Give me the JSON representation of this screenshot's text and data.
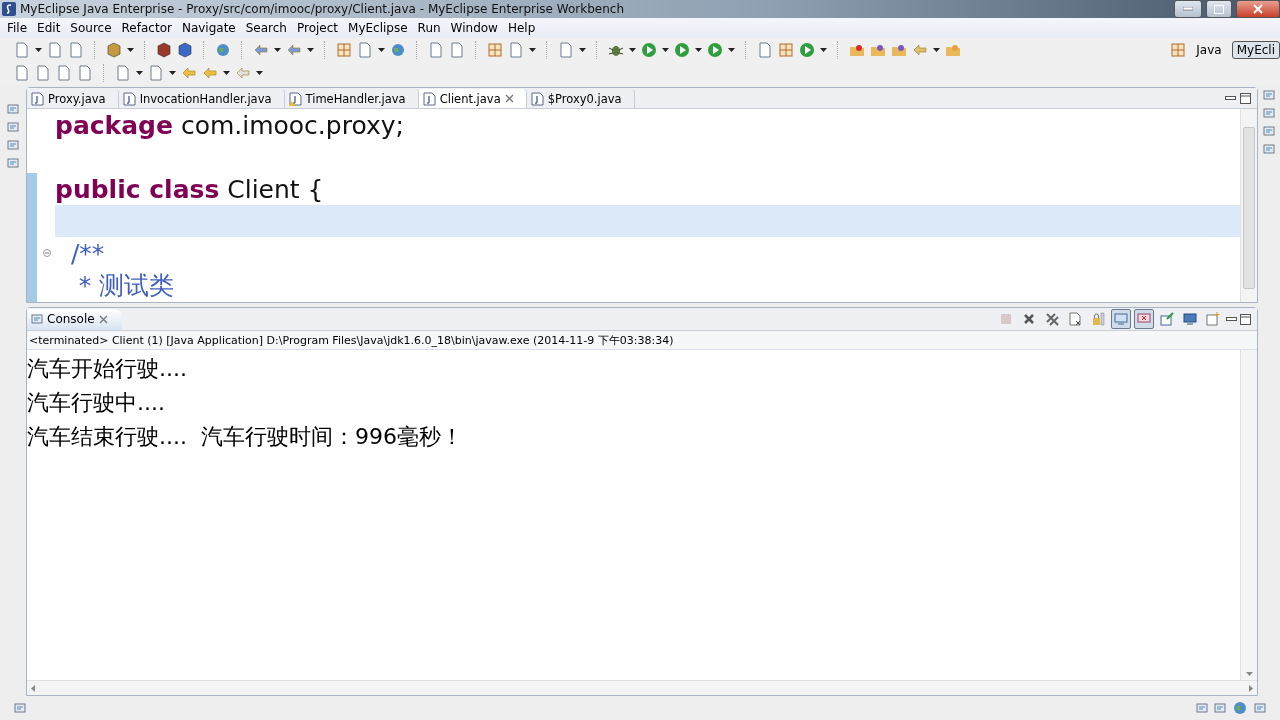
{
  "window": {
    "title": "MyEclipse Java Enterprise - Proxy/src/com/imooc/proxy/Client.java - MyEclipse Enterprise Workbench"
  },
  "menu": [
    "File",
    "Edit",
    "Source",
    "Refactor",
    "Navigate",
    "Search",
    "Project",
    "MyEclipse",
    "Run",
    "Window",
    "Help"
  ],
  "perspectives": [
    {
      "label": "Java",
      "selected": false
    },
    {
      "label": "MyEcli",
      "selected": true
    }
  ],
  "editor_tabs": [
    {
      "label": "Proxy.java",
      "selected": false,
      "warning": false
    },
    {
      "label": "InvocationHandler.java",
      "selected": false,
      "warning": false
    },
    {
      "label": "TimeHandler.java",
      "selected": false,
      "warning": true
    },
    {
      "label": "Client.java",
      "selected": true,
      "warning": false
    },
    {
      "label": "$Proxy0.java",
      "selected": false,
      "warning": false
    }
  ],
  "code_lines": [
    {
      "highlighted": false,
      "tokens": [
        {
          "kind": "keyword",
          "text": "package"
        },
        {
          "kind": "plain",
          "text": " com.imooc.proxy;"
        }
      ]
    },
    {
      "highlighted": false
    },
    {
      "highlighted": false,
      "tokens": [
        {
          "kind": "keyword",
          "text": "public class"
        },
        {
          "kind": "plain",
          "text": " Client {"
        }
      ]
    },
    {
      "highlighted": true
    },
    {
      "highlighted": false,
      "fold": true,
      "tokens": [
        {
          "kind": "comment",
          "text": "  /**"
        }
      ]
    },
    {
      "highlighted": false,
      "tokens": [
        {
          "kind": "comment",
          "text": "   * 测试类"
        }
      ]
    }
  ],
  "console": {
    "title": "Console",
    "info": "<terminated> Client (1) [Java Application] D:\\Program Files\\Java\\jdk1.6.0_18\\bin\\javaw.exe (2014-11-9 下午03:38:34)",
    "tools": [
      {
        "kind": "stop",
        "pressed": false
      },
      {
        "kind": "remove",
        "pressed": false
      },
      {
        "kind": "remove-all",
        "pressed": false
      },
      {
        "kind": "clear",
        "pressed": false
      },
      {
        "kind": "scroll-lock",
        "pressed": false
      },
      {
        "kind": "show-out",
        "pressed": true
      },
      {
        "kind": "show-err",
        "pressed": true
      },
      {
        "kind": "pin",
        "pressed": false
      },
      {
        "kind": "display",
        "pressed": false
      },
      {
        "kind": "new",
        "pressed": false
      }
    ],
    "lines": [
      "汽车开始行驶....",
      "汽车行驶中....",
      "汽车结束行驶....  汽车行驶时间：996毫秒！"
    ]
  }
}
